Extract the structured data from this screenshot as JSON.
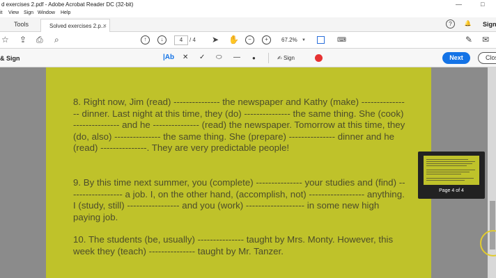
{
  "window": {
    "title": "d exercises 2.pdf - Adobe Acrobat Reader DC (32-bit)",
    "controls": [
      "—",
      "□"
    ]
  },
  "menu": [
    "it",
    "View",
    "Sign",
    "Window",
    "Help"
  ],
  "tabs": {
    "tools_label": "Tools",
    "doc_label": "Solved exercises 2.p...",
    "doc_close": "×",
    "sign_in": "Sign"
  },
  "toolbar": {
    "current_page": "4",
    "total_pages": "/ 4",
    "zoom": "67.2%"
  },
  "signbar": {
    "label": "& Sign",
    "text_tool": "|Ab",
    "sign_label": "Sign",
    "next_label": "Next",
    "close_label": "Clos",
    "accent": "#1473e6"
  },
  "document": {
    "background": "#bfc22a",
    "para8": "8. Right now, Jim (read) --------------- the newspaper and Kathy (make) ---------------- dinner. Last night at this time, they (do) --------------- the same thing. She (cook) --------------- and he --------------- (read)  the newspaper. Tomorrow at this time, they (do, also) --------------- the same thing. She (prepare) --------------- dinner and he (read) ---------------. They are very predictable people!",
    "para9": "9. By this time next summer, you (complete) --------------- your studies and (find) ------------------ a job. I, on the other hand, (accomplish, not) ------------------ anything. I (study, still) ----------------- and you (work) ------------------- in some new high paying job.",
    "para10": "10. The students (be, usually) --------------- taught by Mrs. Monty. However, this week they (teach) --------------- taught by Mr. Tanzer."
  },
  "thumbnail": {
    "label": "Page 4 of 4"
  }
}
